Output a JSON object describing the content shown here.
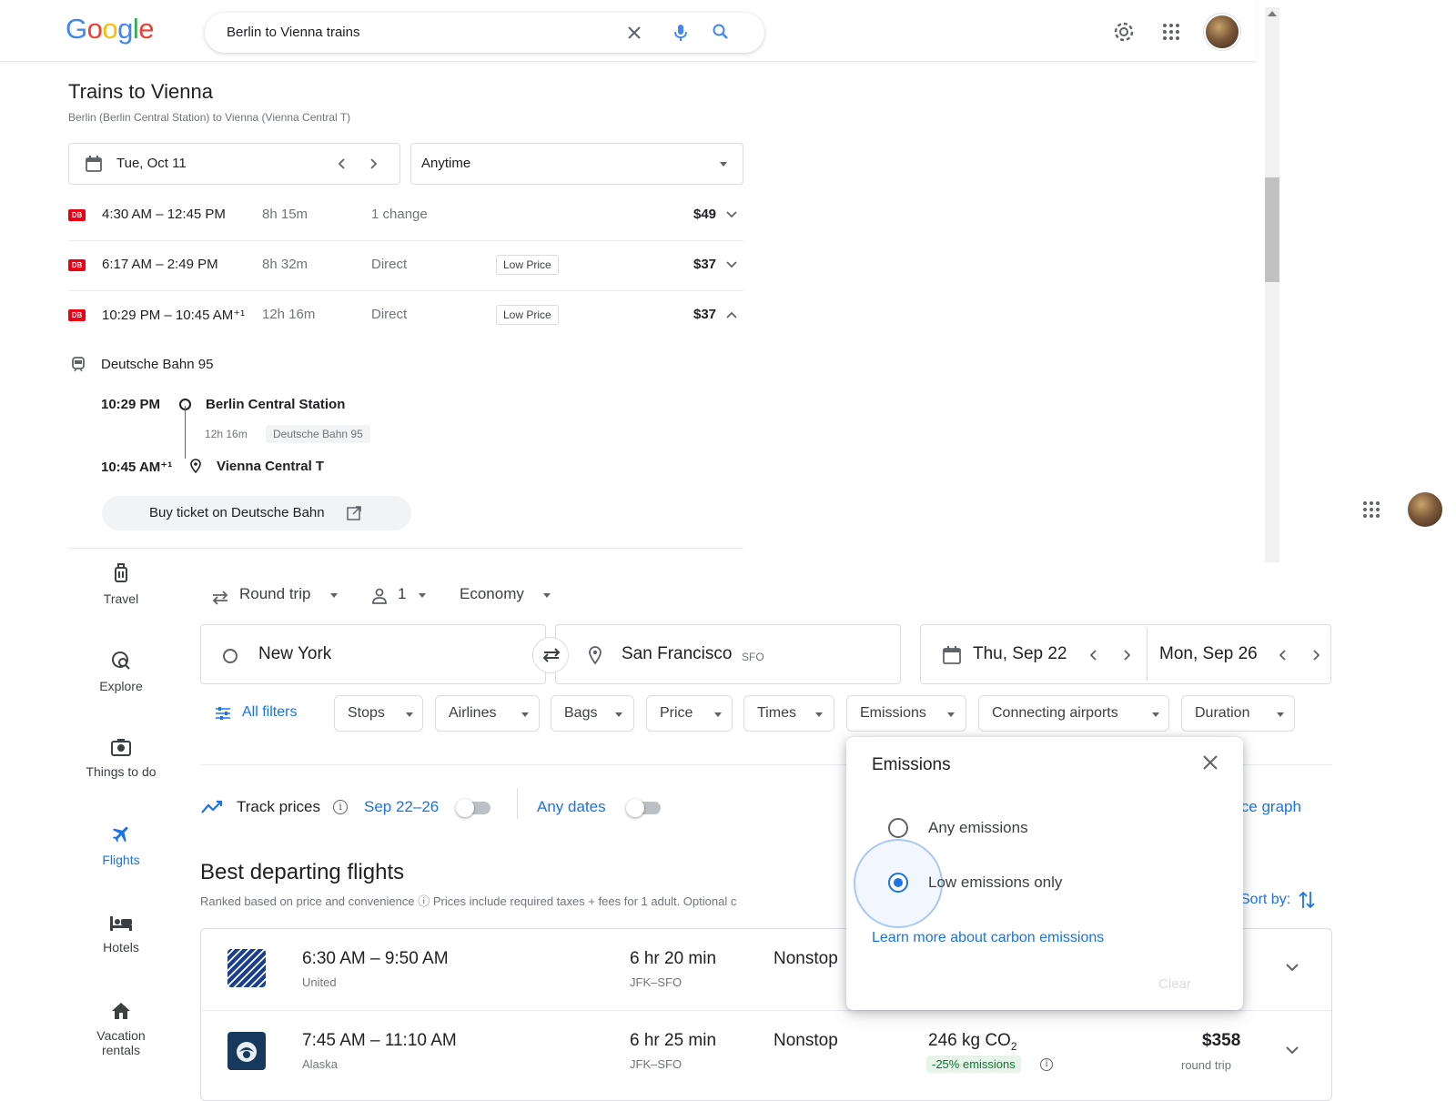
{
  "search": {
    "query": "Berlin to Vienna trains",
    "logo_letters": [
      {
        "ch": "G",
        "color": "#4285f4"
      },
      {
        "ch": "o",
        "color": "#ea4335"
      },
      {
        "ch": "o",
        "color": "#fbbc05"
      },
      {
        "ch": "g",
        "color": "#4285f4"
      },
      {
        "ch": "l",
        "color": "#34a853"
      },
      {
        "ch": "e",
        "color": "#ea4335"
      }
    ]
  },
  "trains": {
    "title": "Trains to Vienna",
    "subtitle": "Berlin (Berlin Central Station) to Vienna (Vienna Central T)",
    "date": "Tue, Oct 11",
    "time_filter": "Anytime",
    "operator_badge": "DB",
    "rows": [
      {
        "time": "4:30 AM – 12:45 PM",
        "duration": "8h 15m",
        "changes": "1 change",
        "badge": "",
        "price": "$49"
      },
      {
        "time": "6:17 AM – 2:49 PM",
        "duration": "8h 32m",
        "changes": "Direct",
        "badge": "Low Price",
        "price": "$37"
      },
      {
        "time": "10:29 PM – 10:45 AM⁺¹",
        "duration": "12h 16m",
        "changes": "Direct",
        "badge": "Low Price",
        "price": "$37"
      }
    ],
    "detail": {
      "train_name": "Deutsche Bahn 95",
      "dep_time": "10:29 PM",
      "dep_station": "Berlin Central Station",
      "segment_duration": "12h 16m",
      "segment_train": "Deutsche Bahn 95",
      "arr_time": "10:45 AM⁺¹",
      "arr_station": "Vienna Central T",
      "buy_label": "Buy ticket on Deutsche Bahn"
    }
  },
  "flights": {
    "nav": [
      {
        "label": "Travel",
        "icon": "luggage-icon"
      },
      {
        "label": "Explore",
        "icon": "explore-icon"
      },
      {
        "label": "Things to do",
        "icon": "camera-icon"
      },
      {
        "label": "Flights",
        "icon": "airplane-icon",
        "active": true
      },
      {
        "label": "Hotels",
        "icon": "bed-icon"
      },
      {
        "label": "Vacation",
        "label2": "rentals",
        "icon": "house-icon"
      }
    ],
    "trip_type": "Round trip",
    "passengers": "1",
    "cabin": "Economy",
    "from": "New York",
    "to": "San Francisco",
    "to_code": "SFO",
    "depart_date": "Thu, Sep 22",
    "return_date": "Mon, Sep 26",
    "filters": {
      "all_filters": "All filters",
      "chips": [
        "Stops",
        "Airlines",
        "Bags",
        "Price",
        "Times",
        "Emissions",
        "Connecting airports",
        "Duration"
      ]
    },
    "track_prices": "Track prices",
    "track_dates": "Sep 22–26",
    "any_dates": "Any dates",
    "price_graph": "ice graph",
    "best_title": "Best departing flights",
    "best_subtitle": "Ranked based on price and convenience ⓘ   Prices include required taxes + fees for 1 adult. Optional c",
    "sort_by": "Sort by:",
    "results": [
      {
        "times": "6:30 AM – 9:50 AM",
        "airline": "United",
        "duration": "6 hr 20 min",
        "route": "JFK–SFO",
        "stops": "Nonstop",
        "logo_color": "#1a3f8f"
      },
      {
        "times": "7:45 AM – 11:10 AM",
        "airline": "Alaska",
        "duration": "6 hr 25 min",
        "route": "JFK–SFO",
        "stops": "Nonstop",
        "co2": "246 kg CO",
        "co2_sub": "2",
        "emissions_badge": "-25% emissions",
        "price": "$358",
        "price_sub": "round trip",
        "logo_color": "#17395c"
      }
    ],
    "emissions_popup": {
      "title": "Emissions",
      "option_any": "Any emissions",
      "option_low": "Low emissions only",
      "selected": "Low emissions only",
      "learn_more": "Learn more about carbon emissions",
      "clear": "Clear"
    }
  },
  "colors": {
    "accent_blue": "#1a73e8",
    "db_red": "#ec0016",
    "green_badge": "#137333"
  }
}
